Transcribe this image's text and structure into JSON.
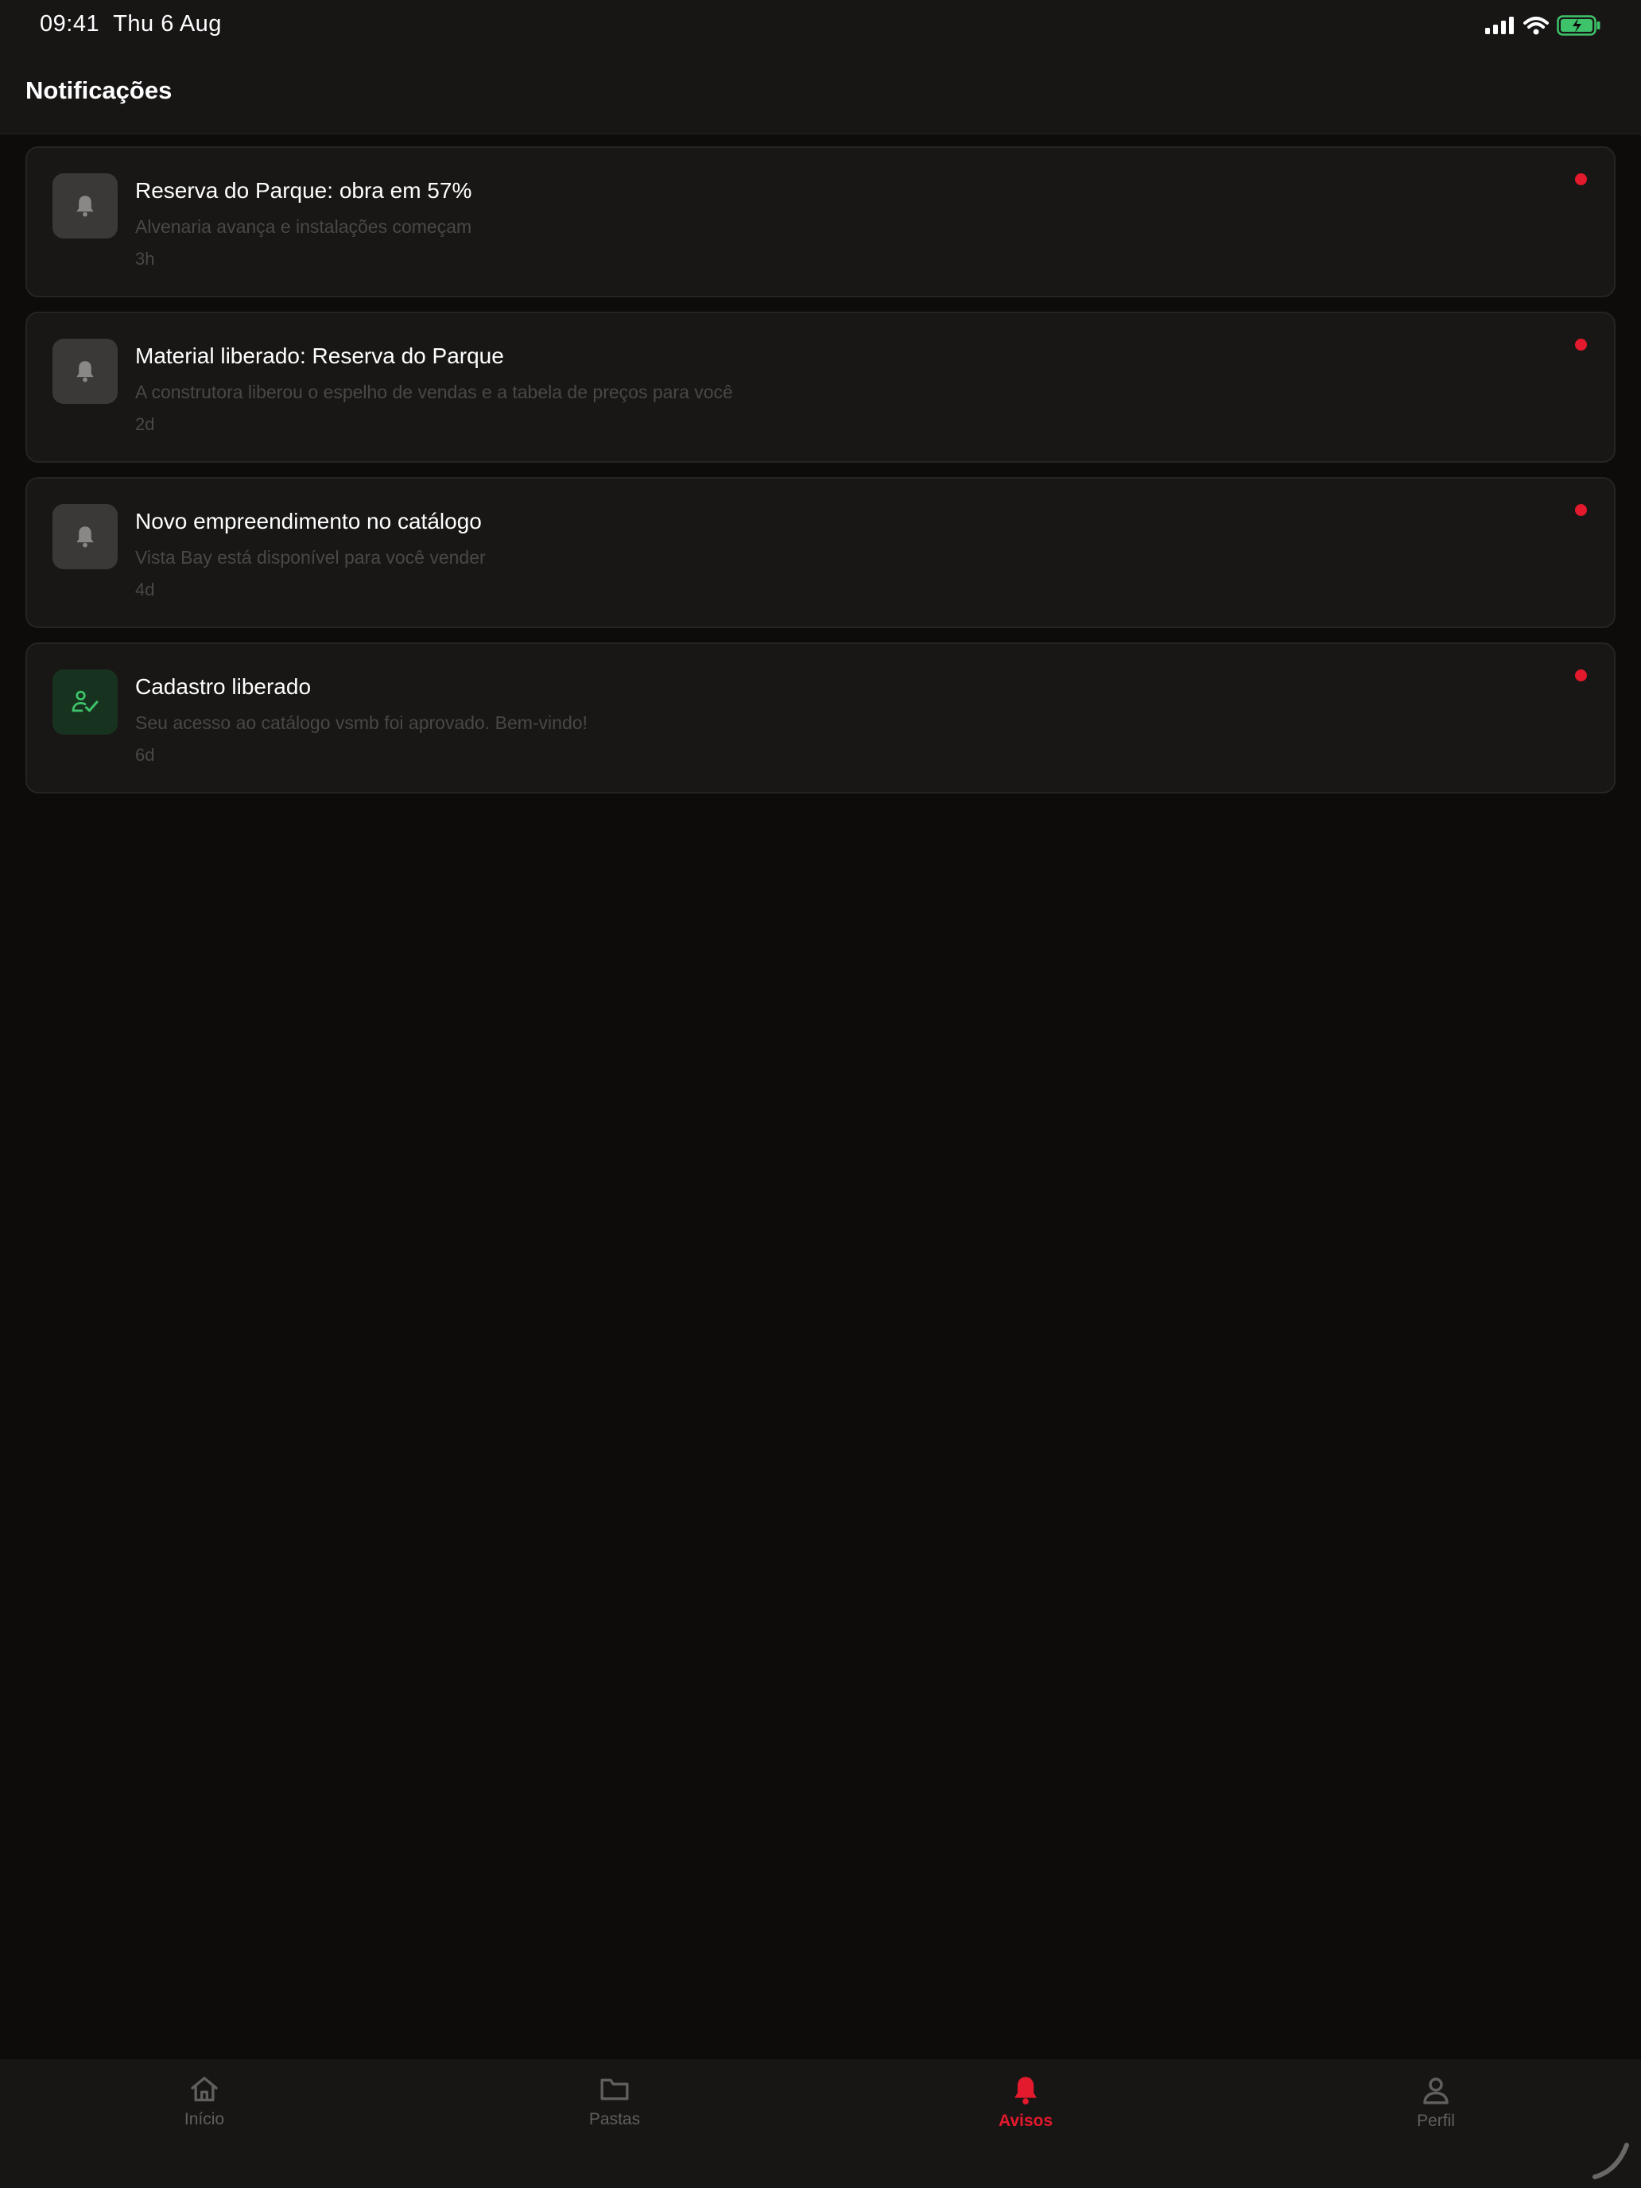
{
  "status_bar": {
    "time": "09:41",
    "date": "Thu 6 Aug",
    "icons": [
      "signal-icon",
      "wifi-icon",
      "battery-charging-icon"
    ]
  },
  "header": {
    "title": "Notificações"
  },
  "notifications": [
    {
      "icon": "bell-icon",
      "title": "Reserva do Parque: obra em 57%",
      "body": "Alvenaria avança e instalações começam",
      "time": "3h",
      "unread": true
    },
    {
      "icon": "bell-icon",
      "title": "Material liberado: Reserva do Parque",
      "body": "A construtora liberou o espelho de vendas e a tabela de preços para você",
      "time": "2d",
      "unread": true
    },
    {
      "icon": "bell-icon",
      "title": "Novo empreendimento no catálogo",
      "body": "Vista Bay está disponível para você vender",
      "time": "4d",
      "unread": true
    },
    {
      "icon": "user-check-icon",
      "title": "Cadastro liberado",
      "body": "Seu acesso ao catálogo vsmb foi aprovado. Bem-vindo!",
      "time": "6d",
      "unread": true
    }
  ],
  "tabbar": {
    "tabs": [
      {
        "label": "Início",
        "icon": "home-icon",
        "active": false
      },
      {
        "label": "Pastas",
        "icon": "folder-icon",
        "active": false
      },
      {
        "label": "Avisos",
        "icon": "bell-icon",
        "active": true
      },
      {
        "label": "Perfil",
        "icon": "user-icon",
        "active": false
      }
    ]
  },
  "colors": {
    "accent": "#e3192d",
    "success": "#3ec36a",
    "background": "#0d0c0b",
    "surface": "#181716"
  }
}
